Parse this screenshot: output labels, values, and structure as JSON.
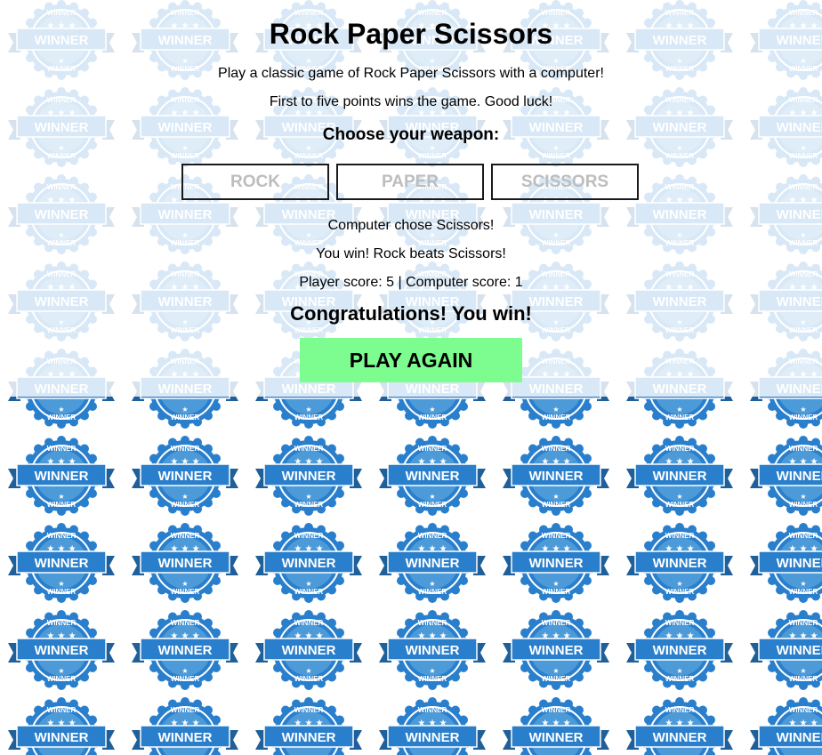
{
  "game": {
    "title": "Rock Paper Scissors",
    "intro": "Play a classic game of Rock Paper Scissors with a computer!",
    "rules": "First to five points wins the game. Good luck!",
    "choose_prompt": "Choose your weapon:",
    "weapons": [
      "ROCK",
      "PAPER",
      "SCISSORS"
    ],
    "computer_choice": "Computer chose Scissors!",
    "round_result": "You win! Rock beats Scissors!",
    "score_text": "Player score: 5 | Computer score: 1",
    "final_message": "Congratulations! You win!",
    "play_again_label": "PLAY AGAIN",
    "player_score": 5,
    "computer_score": 1
  },
  "background": {
    "badge_text": "WINNER",
    "badge_color": "#2a7fcc",
    "badge_light": "#4d9ad8",
    "ribbon_dark": "#1f5f9a"
  },
  "colors": {
    "play_again_bg": "#7dfc8f",
    "weapon_text": "#bdbdbd",
    "weapon_border": "#1a1a1a"
  }
}
